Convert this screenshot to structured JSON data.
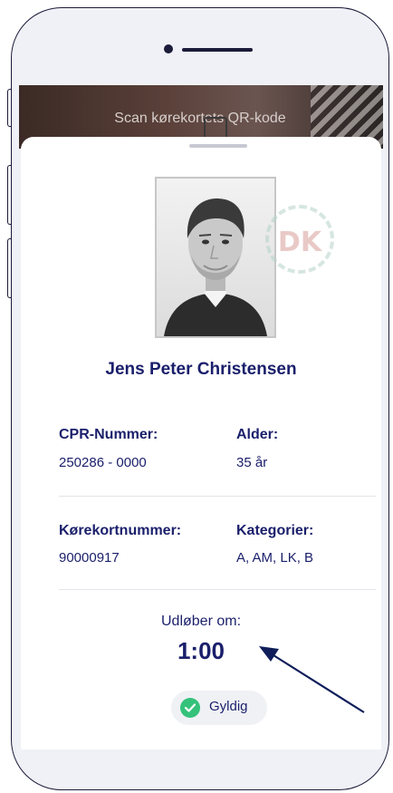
{
  "screen": {
    "scan_prompt": "Scan kørekortets QR-kode"
  },
  "card": {
    "name": "Jens Peter Christensen",
    "seal_text": "DK",
    "fields": [
      {
        "label": "CPR-Nummer:",
        "value": "250286 - 0000"
      },
      {
        "label": "Alder:",
        "value": "35 år"
      },
      {
        "label": "Kørekortnummer:",
        "value": "90000917"
      },
      {
        "label": "Kategorier:",
        "value": "A, AM, LK, B"
      }
    ],
    "expires_label": "Udløber om:",
    "timer": "1:00",
    "status": "Gyldig"
  },
  "icons": {
    "status": "check-icon",
    "annotation": "arrow-icon"
  },
  "colors": {
    "primary_text": "#1a1f6b",
    "valid_green": "#34c27a",
    "arrow": "#0f1e5a"
  }
}
